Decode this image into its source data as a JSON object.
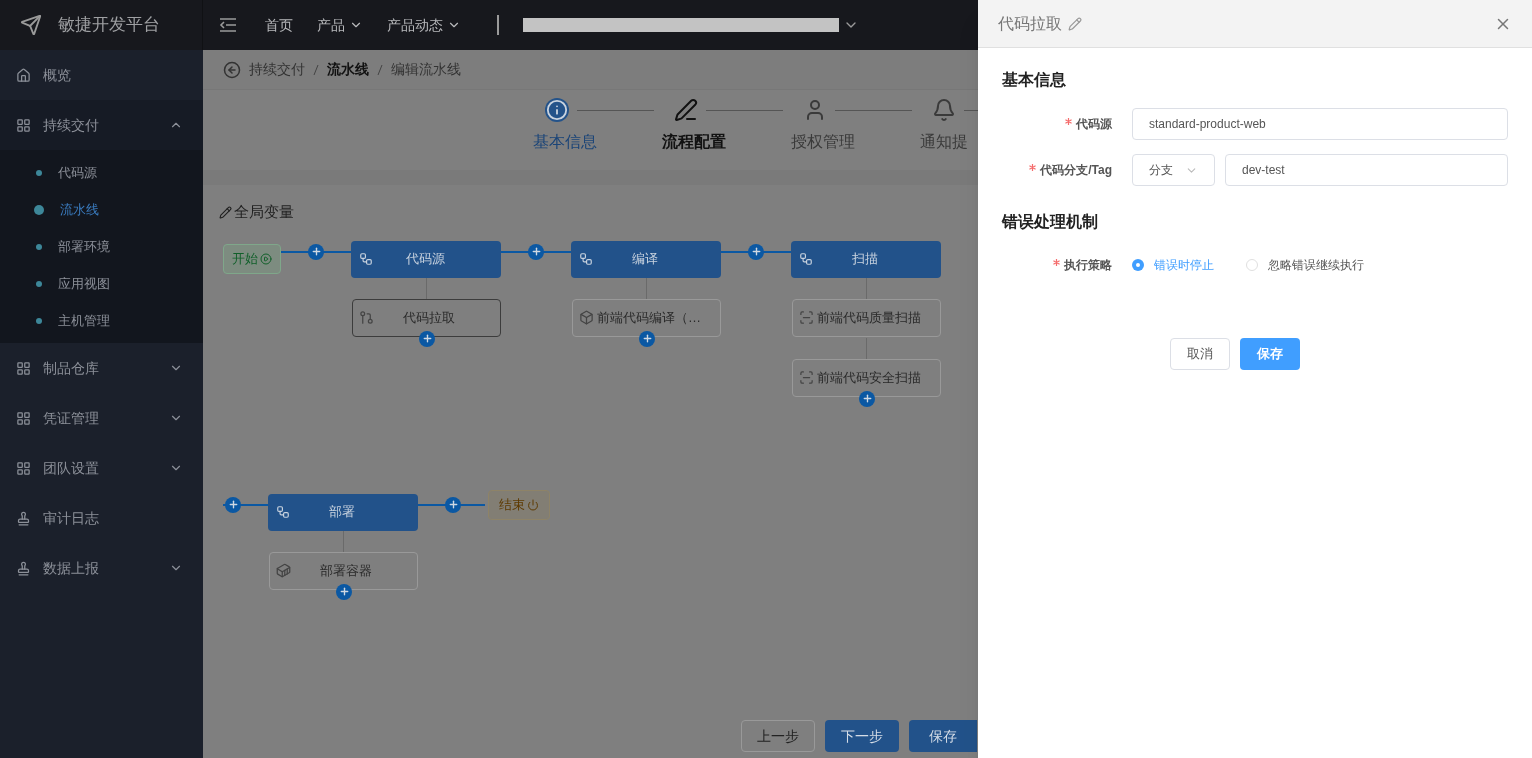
{
  "header": {
    "brand": "敏捷开发平台",
    "nav": [
      {
        "label": "首页",
        "dropdown": false
      },
      {
        "label": "产品",
        "dropdown": true
      },
      {
        "label": "产品动态",
        "dropdown": true
      }
    ]
  },
  "sidebar": {
    "items": [
      {
        "label": "概览",
        "kind": "link"
      },
      {
        "label": "持续交付",
        "kind": "group",
        "expanded": true,
        "children": [
          {
            "label": "代码源",
            "selected": false
          },
          {
            "label": "流水线",
            "selected": true
          },
          {
            "label": "部署环境",
            "selected": false
          },
          {
            "label": "应用视图",
            "selected": false
          },
          {
            "label": "主机管理",
            "selected": false
          }
        ]
      },
      {
        "label": "制品仓库",
        "kind": "group",
        "expanded": false
      },
      {
        "label": "凭证管理",
        "kind": "group",
        "expanded": false
      },
      {
        "label": "团队设置",
        "kind": "group",
        "expanded": false
      },
      {
        "label": "审计日志",
        "kind": "link"
      },
      {
        "label": "数据上报",
        "kind": "group",
        "expanded": false
      }
    ]
  },
  "breadcrumb": [
    {
      "label": "持续交付",
      "current": false
    },
    {
      "label": "流水线",
      "current": true
    },
    {
      "label": "编辑流水线",
      "current": false
    }
  ],
  "steps": [
    {
      "label": "基本信息",
      "done": true,
      "selected": false
    },
    {
      "label": "流程配置",
      "done": false,
      "selected": true
    },
    {
      "label": "授权管理",
      "done": false,
      "selected": false
    },
    {
      "label": "通知提",
      "done": false,
      "selected": false
    }
  ],
  "global_vars": "全局变量",
  "pipeline": {
    "rows": [
      {
        "start": "开始",
        "stages": [
          {
            "name": "代码源",
            "tasks": [
              {
                "name": "代码拉取",
                "kind": "checkout",
                "selected": true
              }
            ]
          },
          {
            "name": "编译",
            "tasks": [
              {
                "name": "前端代码编译（…",
                "kind": "build",
                "selected": false
              }
            ]
          },
          {
            "name": "扫描",
            "tasks": [
              {
                "name": "前端代码质量扫描",
                "kind": "scan",
                "selected": false
              },
              {
                "name": "前端代码安全扫描",
                "kind": "scan",
                "selected": false
              }
            ]
          }
        ]
      },
      {
        "end": "结束",
        "stages": [
          {
            "name": "部署",
            "tasks": [
              {
                "name": "部署容器",
                "kind": "deploy",
                "selected": false
              }
            ]
          }
        ]
      }
    ]
  },
  "footer_buttons": [
    {
      "label": "上一步",
      "kind": "default"
    },
    {
      "label": "下一步",
      "kind": "primary"
    },
    {
      "label": "保存",
      "kind": "primary"
    }
  ],
  "drawer": {
    "title": "代码拉取",
    "sections": [
      {
        "title": "基本信息",
        "fields": [
          {
            "label": "代码源",
            "required": true,
            "kind": "input",
            "value": "standard-product-web"
          },
          {
            "label": "代码分支/Tag",
            "required": true,
            "kind": "select-input",
            "select": "分支",
            "value": "dev-test"
          }
        ]
      },
      {
        "title": "错误处理机制",
        "fields": [
          {
            "label": "执行策略",
            "required": true,
            "kind": "radio",
            "options": [
              {
                "label": "错误时停止",
                "selected": true
              },
              {
                "label": "忽略错误继续执行",
                "selected": false
              }
            ]
          }
        ]
      }
    ],
    "buttons": [
      {
        "label": "取消",
        "kind": "default"
      },
      {
        "label": "保存",
        "kind": "primary"
      }
    ]
  }
}
